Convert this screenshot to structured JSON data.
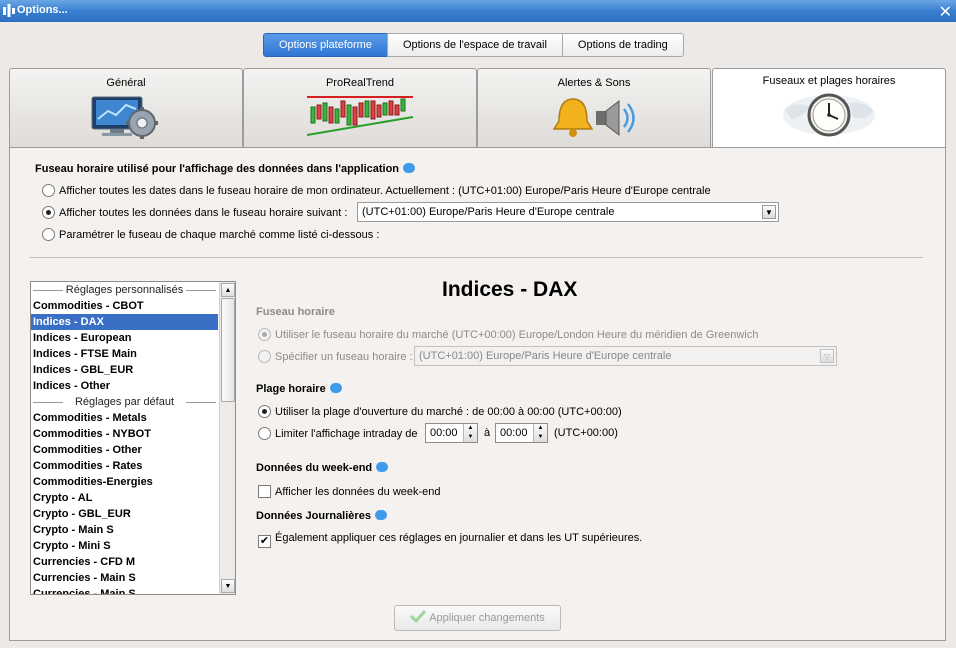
{
  "window": {
    "title": "Options...",
    "close_glyph": "✕"
  },
  "top_segments": [
    {
      "label": "Options plateforme",
      "active": true
    },
    {
      "label": "Options de l'espace de travail",
      "active": false
    },
    {
      "label": "Options de trading",
      "active": false
    }
  ],
  "tabs": [
    {
      "label": "Général",
      "icon": "monitor-gear-icon"
    },
    {
      "label": "ProRealTrend",
      "icon": "candlestick-trend-icon"
    },
    {
      "label": "Alertes & Sons",
      "icon": "bell-speaker-icon"
    },
    {
      "label": "Fuseaux et plages horaires",
      "icon": "clock-world-icon",
      "active": true
    }
  ],
  "timezone_section": {
    "heading": "Fuseau horaire utilisé pour l'affichage des données dans l'application",
    "opt1": "Afficher toutes les dates dans le fuseau horaire de mon ordinateur. Actuellement : (UTC+01:00) Europe/Paris Heure d'Europe centrale",
    "opt2": "Afficher toutes les données dans le fuseau horaire suivant :",
    "opt2_value": "(UTC+01:00) Europe/Paris Heure d'Europe centrale",
    "opt3": "Paramétrer le fuseau de chaque marché comme listé ci-dessous :",
    "selected": 2
  },
  "market_list": {
    "group_custom": "Réglages personnalisés",
    "custom_items": [
      "Commodities - CBOT",
      "Indices - DAX",
      "Indices - European",
      "Indices - FTSE Main",
      "Indices - GBL_EUR",
      "Indices - Other"
    ],
    "group_default": "Réglages par défaut",
    "default_items": [
      "Commodities - Metals",
      "Commodities - NYBOT",
      "Commodities - Other",
      "Commodities - Rates",
      "Commodities-Energies",
      "Crypto - AL",
      "Crypto - GBL_EUR",
      "Crypto - Main S",
      "Crypto - Mini S",
      "Currencies - CFD M",
      "Currencies - Main S",
      "Currencies - Main S"
    ],
    "selected": "Indices - DAX"
  },
  "detail": {
    "title": "Indices - DAX",
    "tz_heading": "Fuseau horaire",
    "tz_opt1": "Utiliser le fuseau horaire du marché (UTC+00:00) Europe/London Heure du méridien de Greenwich",
    "tz_opt2": "Spécifier un fuseau horaire :",
    "tz_opt2_value": "(UTC+01:00) Europe/Paris Heure d'Europe centrale",
    "range_heading": "Plage horaire",
    "range_opt1": "Utiliser la plage d'ouverture du marché : de 00:00 à 00:00  (UTC+00:00)",
    "range_opt2": "Limiter l'affichage intraday  de",
    "range_from": "00:00",
    "range_to_label": "à",
    "range_to": "00:00",
    "range_tz": "(UTC+00:00)",
    "weekend_heading": "Données du week-end",
    "weekend_check": "Afficher les données du week-end",
    "weekend_checked": false,
    "daily_heading": "Données Journalières",
    "daily_check": "Également appliquer ces réglages en journalier et dans les UT supérieures.",
    "daily_checked": true
  },
  "apply_button": "Appliquer changements",
  "colors": {
    "accent": "#2f76d4",
    "selection": "#3b6fc6",
    "info": "#3d9be9"
  }
}
